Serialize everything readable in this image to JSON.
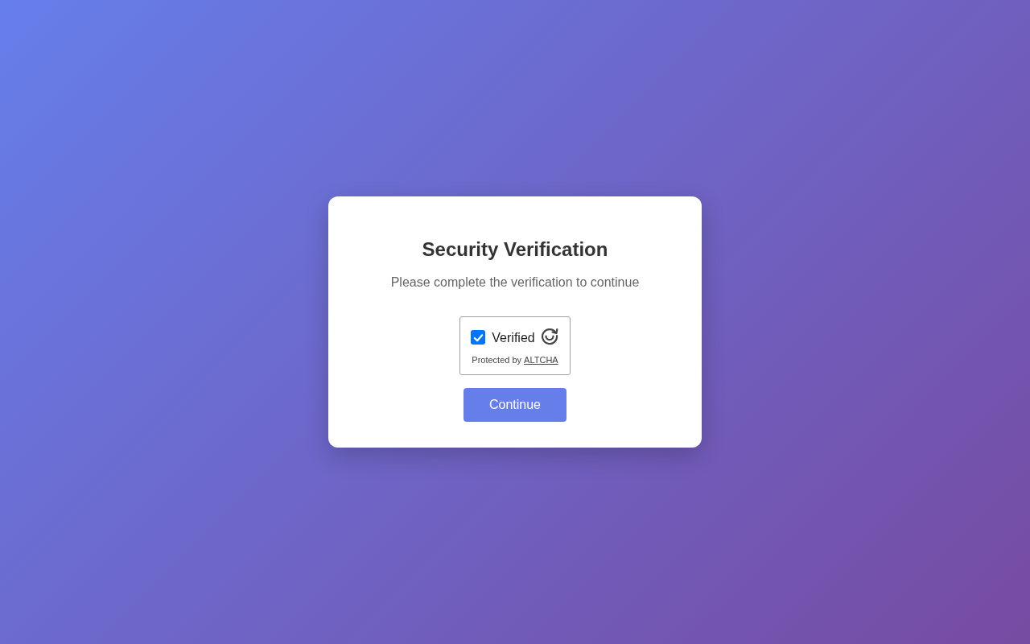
{
  "card": {
    "title": "Security Verification",
    "subtitle": "Please complete the verification to continue",
    "widget": {
      "checkbox": {
        "label": "Verified",
        "checked": true
      },
      "footer": {
        "text": "Protected by",
        "link": "ALTCHA"
      }
    },
    "button": {
      "label": "Continue"
    }
  }
}
